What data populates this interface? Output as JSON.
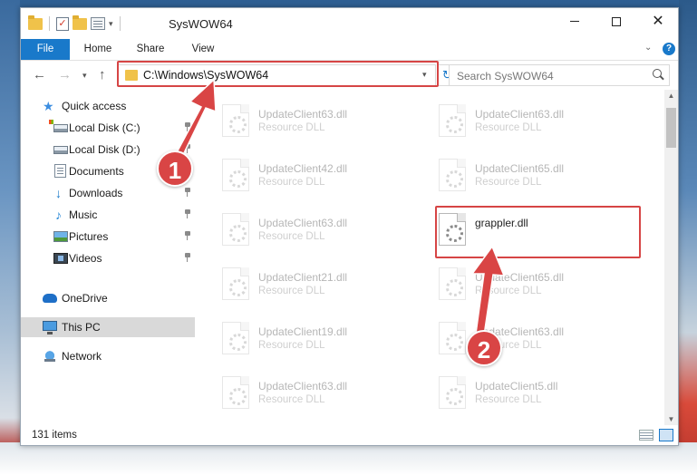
{
  "window": {
    "title": "SysWOW64"
  },
  "ribbon": {
    "tabs": [
      {
        "label": "File"
      },
      {
        "label": "Home"
      },
      {
        "label": "Share"
      },
      {
        "label": "View"
      }
    ],
    "help": "?"
  },
  "nav": {
    "address": "C:\\Windows\\SysWOW64",
    "search_placeholder": "Search SysWOW64"
  },
  "sidebar": {
    "items": [
      {
        "label": "Quick access",
        "icon": "star-icon"
      },
      {
        "label": "Local Disk (C:)",
        "icon": "drive-icon",
        "pinned": true
      },
      {
        "label": "Local Disk (D:)",
        "icon": "drive-icon",
        "pinned": true
      },
      {
        "label": "Documents",
        "icon": "documents-icon",
        "pinned": true
      },
      {
        "label": "Downloads",
        "icon": "downloads-icon",
        "pinned": true
      },
      {
        "label": "Music",
        "icon": "music-icon",
        "pinned": true
      },
      {
        "label": "Pictures",
        "icon": "pictures-icon",
        "pinned": true
      },
      {
        "label": "Videos",
        "icon": "videos-icon",
        "pinned": true
      },
      {
        "label": "OneDrive",
        "icon": "cloud-icon"
      },
      {
        "label": "This PC",
        "icon": "computer-icon",
        "selected": true
      },
      {
        "label": "Network",
        "icon": "network-icon"
      }
    ]
  },
  "files": {
    "left": [
      {
        "name": "UpdateClient63.dll",
        "type": "Resource DLL"
      },
      {
        "name": "UpdateClient42.dll",
        "type": "Resource DLL"
      },
      {
        "name": "UpdateClient63.dll",
        "type": "Resource DLL"
      },
      {
        "name": "UpdateClient21.dll",
        "type": "Resource DLL"
      },
      {
        "name": "UpdateClient19.dll",
        "type": "Resource DLL"
      },
      {
        "name": "UpdateClient63.dll",
        "type": "Resource DLL"
      }
    ],
    "right": [
      {
        "name": "UpdateClient63.dll",
        "type": "Resource DLL"
      },
      {
        "name": "UpdateClient65.dll",
        "type": "Resource DLL"
      },
      {
        "name": "grappler.dll",
        "type": ""
      },
      {
        "name": "UpdateClient65.dll",
        "type": "Resource DLL"
      },
      {
        "name": "UpdateClient63.dll",
        "type": "Resource DLL"
      },
      {
        "name": "UpdateClient5.dll",
        "type": "Resource DLL"
      }
    ]
  },
  "status": {
    "count": "131 items"
  },
  "annotations": {
    "step1": "1",
    "step2": "2",
    "color": "#d94545"
  }
}
